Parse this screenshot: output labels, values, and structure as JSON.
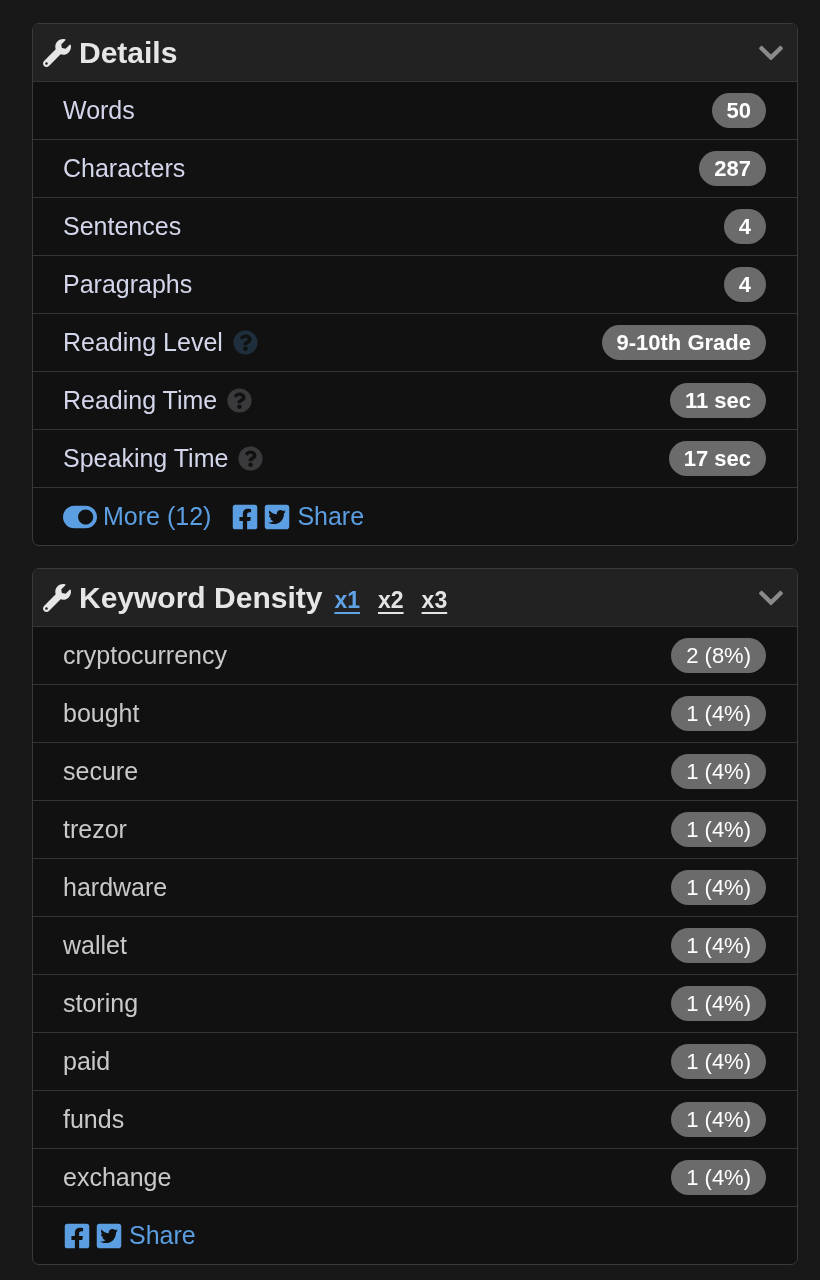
{
  "details": {
    "title": "Details",
    "rows": [
      {
        "label": "Words",
        "value": "50"
      },
      {
        "label": "Characters",
        "value": "287"
      },
      {
        "label": "Sentences",
        "value": "4"
      },
      {
        "label": "Paragraphs",
        "value": "4"
      },
      {
        "label": "Reading Level",
        "value": "9-10th Grade",
        "help": {
          "color": "#1f2e3c"
        }
      },
      {
        "label": "Reading Time",
        "value": "11 sec",
        "help": {
          "color": "#3a3a3c"
        }
      },
      {
        "label": "Speaking Time",
        "value": "17 sec",
        "help": {
          "color": "#3a3a3c"
        }
      }
    ],
    "footer": {
      "more": "More (12)",
      "share": "Share"
    }
  },
  "keyword_density": {
    "title": "Keyword Density",
    "tabs": [
      {
        "label": "x1",
        "selected": true
      },
      {
        "label": "x2",
        "selected": false
      },
      {
        "label": "x3",
        "selected": false
      }
    ],
    "rows": [
      {
        "keyword": "cryptocurrency",
        "count": "2 (8%)"
      },
      {
        "keyword": "bought",
        "count": "1 (4%)"
      },
      {
        "keyword": "secure",
        "count": "1 (4%)"
      },
      {
        "keyword": "trezor",
        "count": "1 (4%)"
      },
      {
        "keyword": "hardware",
        "count": "1 (4%)"
      },
      {
        "keyword": "wallet",
        "count": "1 (4%)"
      },
      {
        "keyword": "storing",
        "count": "1 (4%)"
      },
      {
        "keyword": "paid",
        "count": "1 (4%)"
      },
      {
        "keyword": "funds",
        "count": "1 (4%)"
      },
      {
        "keyword": "exchange",
        "count": "1 (4%)"
      }
    ],
    "footer": {
      "share": "Share"
    }
  }
}
